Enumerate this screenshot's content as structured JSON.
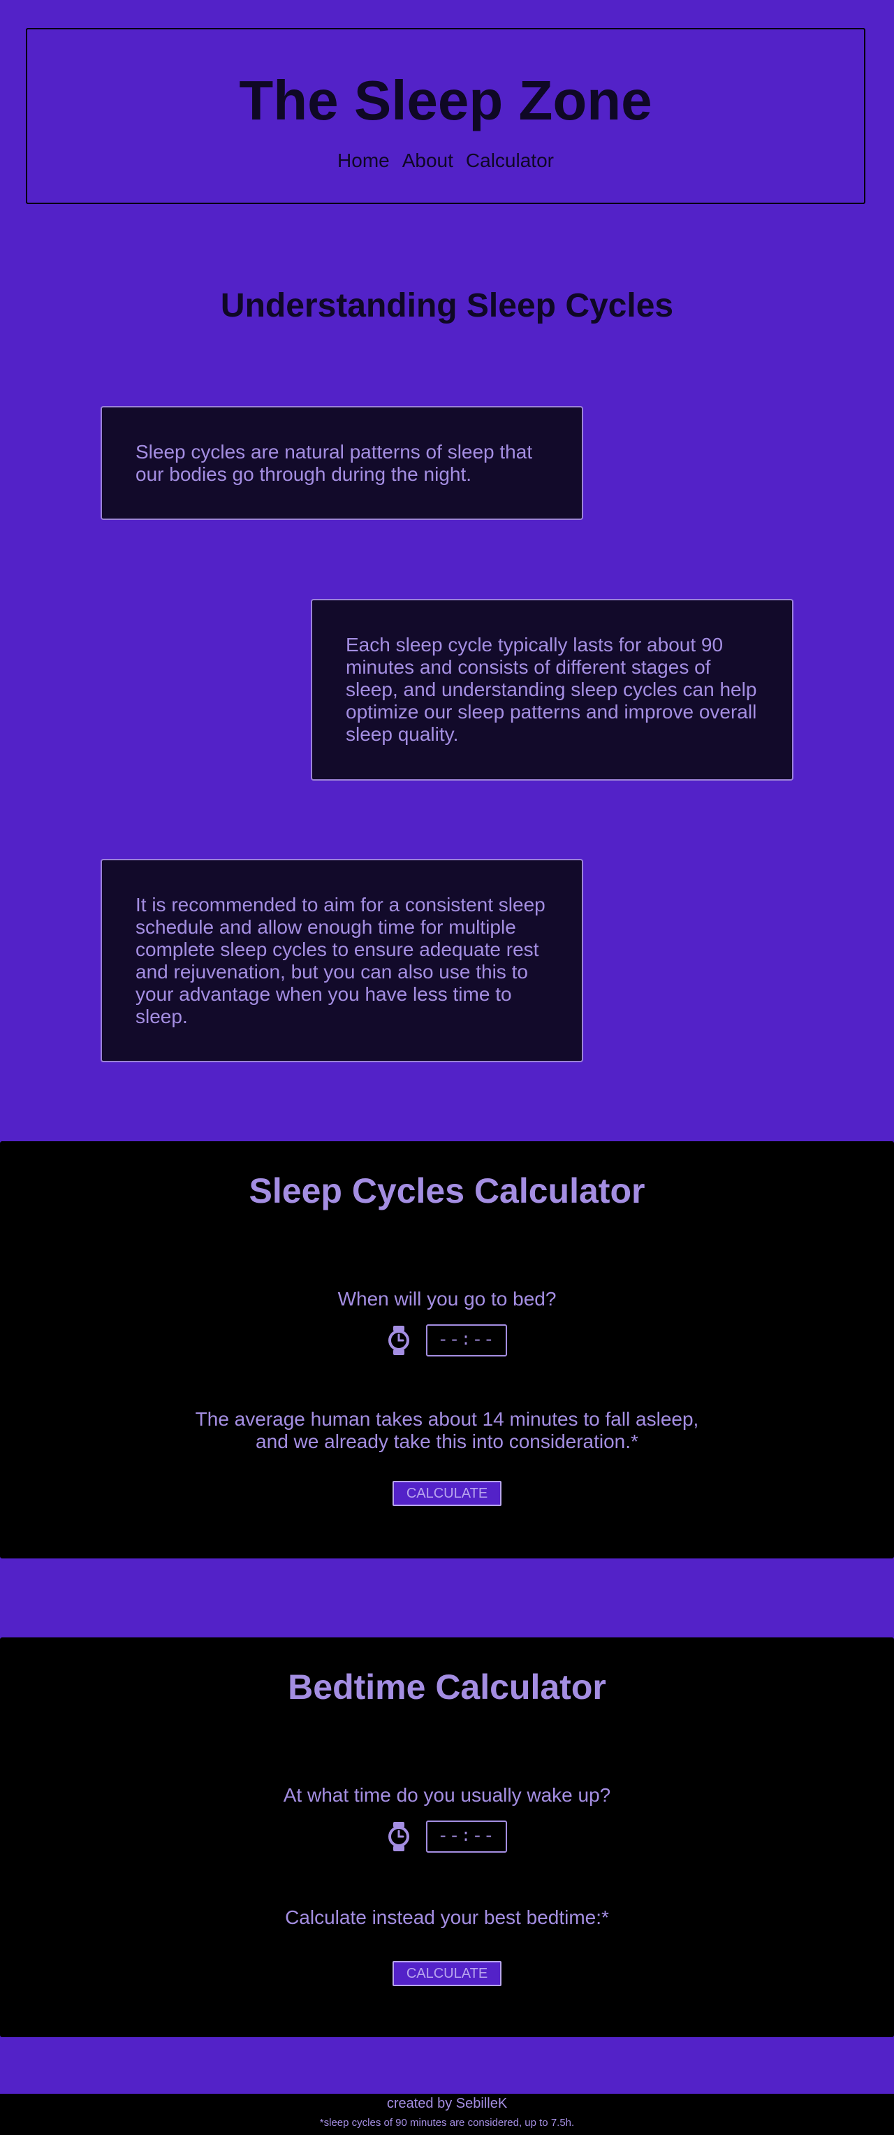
{
  "header": {
    "title": "The Sleep Zone",
    "nav": [
      "Home",
      "About",
      "Calculator"
    ]
  },
  "intro": {
    "title": "Understanding Sleep Cycles",
    "cards": [
      "Sleep cycles are natural patterns of sleep that our bodies go through during the night.",
      "Each sleep cycle typically lasts for about 90 minutes and consists of different stages of sleep, and understanding sleep cycles can help optimize our sleep patterns and improve overall sleep quality.",
      "It is recommended to aim for a consistent sleep schedule and allow enough time for multiple complete sleep cycles to ensure adequate rest and rejuvenation, but you can also use this to your advantage when you have less time to sleep."
    ]
  },
  "sleep_calculator": {
    "title": "Sleep Cycles Calculator",
    "question": "When will you go to bed?",
    "time_placeholder": "--:--",
    "note_line1": "The average human takes about 14 minutes to fall asleep,",
    "note_line2": "and we already take this into consideration.*",
    "button_label": "CALCULATE"
  },
  "bedtime_calculator": {
    "title": "Bedtime Calculator",
    "question": "At what time do you usually wake up?",
    "time_placeholder": "--:--",
    "note": "Calculate instead your best bedtime:*",
    "button_label": "CALCULATE"
  },
  "footer": {
    "credit": "created by SebilleK",
    "note": "*sleep cycles of 90 minutes are considered, up to 7.5h."
  },
  "colors": {
    "page_background": "#5322c8",
    "card_background": "#120a2a",
    "accent_text": "#a48ee2",
    "dark_text": "#0f0825"
  }
}
